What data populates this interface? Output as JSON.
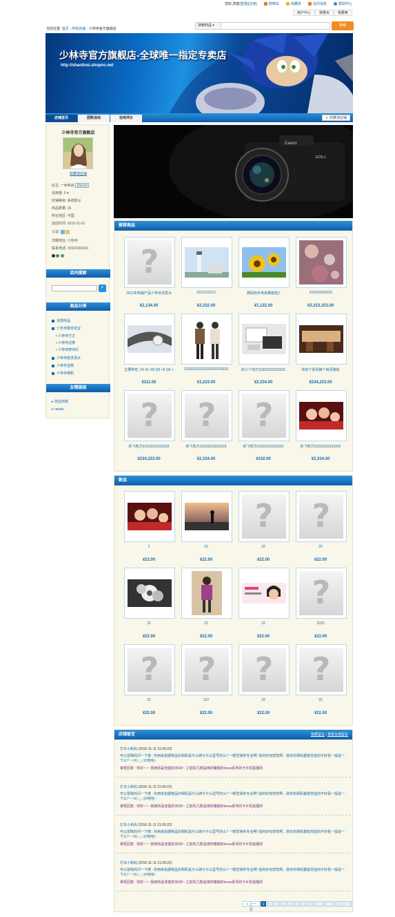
{
  "topbar": {
    "greeting": "您好,游客",
    "login": "[登录]",
    "register": "[注册]",
    "links": [
      {
        "label": "购物车",
        "icon": "cart-icon",
        "color": "#e07c1e"
      },
      {
        "label": "收藏夹",
        "icon": "star-icon",
        "color": "#f2b320"
      },
      {
        "label": "站内消息",
        "icon": "mail-icon",
        "color": "#e07c1e"
      },
      {
        "label": "帮助中心",
        "icon": "help-icon",
        "color": "#2a8fd8"
      }
    ],
    "user_menu": [
      "用户中心",
      "我要买",
      "我要卖"
    ]
  },
  "breadcrumb": {
    "prefix": "当前位置:",
    "items": [
      "首页",
      "所有店铺",
      "少林寺官方旗舰店"
    ]
  },
  "search": {
    "category": "搜索商品",
    "placeholder": "",
    "button": "搜索"
  },
  "banner": {
    "title": "少林寺官方旗舰店-全球唯一指定专卖店",
    "url": "http://shaolinsi.shopnc.net"
  },
  "nav": {
    "tabs": [
      "店铺首页",
      "团购活动",
      "信用评价"
    ],
    "favorite": "收藏该店铺"
  },
  "store": {
    "name": "少林寺官方旗舰店",
    "favorite_link": "收藏该店铺",
    "info": [
      {
        "label": "店主:",
        "value": "一休和尚",
        "tag": "发站内信"
      },
      {
        "label": "信用度:",
        "value": "0"
      },
      {
        "label": "店铺等级:",
        "value": "系统默认"
      },
      {
        "label": "商品数量:",
        "value": "26"
      },
      {
        "label": "所在地区:",
        "value": "中国"
      },
      {
        "label": "创店时间:",
        "value": "2010-11-22"
      },
      {
        "label": "认证:",
        "value": ""
      },
      {
        "label": "详细地址:",
        "value": "少林寺"
      },
      {
        "label": "联系电话:",
        "value": "15922282341"
      }
    ]
  },
  "sidebar": {
    "search_title": "店内搜索",
    "search_placeholder": "",
    "category_title": "商品分类",
    "categories": [
      {
        "label": "全部商品",
        "level": 0
      },
      {
        "label": "少年寺蕾寺龙宝",
        "level": 0
      },
      {
        "label": "少林寺方丈",
        "level": 1
      },
      {
        "label": "少林寺达摩",
        "level": 1
      },
      {
        "label": "少林寺摩诃衍",
        "level": 1
      },
      {
        "label": "少林寺唐洗发水",
        "level": 0
      },
      {
        "label": "少林寺宝典",
        "level": 0
      },
      {
        "label": "少林寺相机",
        "level": 0
      }
    ],
    "links_title": "友情链接",
    "links": [
      "淘宝商城",
      "ramdu"
    ]
  },
  "recommended": {
    "title": "推荐商品",
    "items": [
      {
        "name": "2012年热销产品少林寺洗发水",
        "price": "¥2,134.00",
        "img": "placeholder"
      },
      {
        "name": "2222222222",
        "price": "¥2,332.00",
        "img": "lighthouse"
      },
      {
        "name": "数码的手电系螺旋型2",
        "price": "¥1,122.00",
        "img": "sunflower"
      },
      {
        "name": "333333333333",
        "price": "¥3,333,333.00",
        "img": "bokeh"
      },
      {
        "name": "主要特性: (% W. H8 Q5 >8 Q5 >",
        "price": "¥111.00",
        "img": "watch"
      },
      {
        "name": "23333333333333333333333",
        "price": "¥3,223.00",
        "img": "fashion"
      },
      {
        "name": "的三十地方33333333333333",
        "price": "¥2,334.00",
        "img": "desk"
      },
      {
        "name": "的的个的风格个和风格和",
        "price": "¥234,223.00",
        "img": "room"
      },
      {
        "name": "的飞地方33333333333333",
        "price": "¥234,223.00",
        "img": "placeholder"
      },
      {
        "name": "的飞地方33333333333333",
        "price": "¥2,334.00",
        "img": "placeholder"
      },
      {
        "name": "的飞地方33333333333333",
        "price": "¥332.00",
        "img": "placeholder"
      },
      {
        "name": "的飞地方33333333333333",
        "price": "¥2,334.00",
        "img": "party"
      }
    ]
  },
  "newproducts": {
    "title": "新品",
    "items": [
      {
        "name": "2",
        "price": "¥22.00",
        "img": "party"
      },
      {
        "name": "22",
        "price": "¥22.00",
        "img": "sunset"
      },
      {
        "name": "22",
        "price": "¥22.00",
        "img": "placeholder"
      },
      {
        "name": "22",
        "price": "¥22.00",
        "img": "placeholder"
      },
      {
        "name": "22",
        "price": "¥22.00",
        "img": "flower"
      },
      {
        "name": "22",
        "price": "¥22.00",
        "img": "girl"
      },
      {
        "name": "22",
        "price": "¥22.00",
        "img": "ad"
      },
      {
        "name": "2222",
        "price": "¥22.00",
        "img": "placeholder"
      },
      {
        "name": "22",
        "price": "¥22.00",
        "img": "placeholder"
      },
      {
        "name": "222",
        "price": "¥22.00",
        "img": "placeholder"
      },
      {
        "name": "22",
        "price": "¥22.00",
        "img": "placeholder"
      },
      {
        "name": "22",
        "price": "¥22.00",
        "img": "placeholder"
      }
    ]
  },
  "messages": {
    "title": "店铺留言",
    "links": [
      "我要留言",
      "查看全部留言"
    ],
    "items": [
      {
        "author": "打伞小和尚",
        "time": "(2010-11-11 21:00:22)",
        "text": "可以冒昧的问一下楼 : 你用来拍摄物品的相机是什么牌子什么型号的么? 一眼觉得你专业啊! 拍的好有感觉啊…我买的相机都能觉拍的不好看一般说一下么? ~~0(∩_∩)O哈哈~",
        "reply": "掌柜回复 : 你好~~~ 我用的是佳能的350D~ 之前的几款是用的罐装的lexus系列的卡片机拍摄的"
      },
      {
        "author": "打伞小和尚",
        "time": "(2010-11-11 21:00:22)",
        "text": "可以冒昧的问一下楼 : 你用来拍摄物品的相机是什么牌子什么型号的么? 一眼觉得你专业啊! 拍的好有感觉啊…我买的相机都能觉拍的不好看一般说一下么? ~~0(∩_∩)O哈哈~",
        "reply": "掌柜回复 : 你好~~~ 我用的是佳能的350D~ 之前的几款是用的罐装的lexus系列的卡片机拍摄的"
      },
      {
        "author": "打伞小和尚",
        "time": "(2010-11-11 21:00:22)",
        "text": "可以冒昧的问一下楼 : 你用来拍摄物品的相机是什么牌子什么型号的么? 一眼觉得你专业啊! 拍的好有感觉啊…我买的相机都能觉拍的不好看一般说一下么? ~~0(∩_∩)O哈哈~",
        "reply": "掌柜回复 : 你好~~~ 我用的是佳能的350D~ 之前的几款是用的罐装的lexus系列的卡片机拍摄的"
      },
      {
        "author": "打伞小和尚",
        "time": "(2010-11-11 21:00:22)",
        "text": "可以冒昧的问一下楼 : 你用来拍摄物品的相机是什么牌子什么型号的么? 一眼觉得你专业啊! 拍的好有感觉啊…我买的相机都能觉拍的不好看一般说一下么? ~~0(∩_∩)O哈哈~",
        "reply": "掌柜回复 : 你好~~~ 我用的是佳能的350D~ 之前的几款是用的罐装的lexus系列的卡片机拍摄的"
      }
    ]
  },
  "pager": {
    "prev": "< 上一页",
    "pages": [
      "1",
      "2",
      "3",
      "4",
      "5",
      "6",
      "7",
      "...",
      "199",
      "200"
    ],
    "next": "下一页 >",
    "current": "1"
  },
  "colors": {
    "accent": "#1a6aa8",
    "header_blue": "#0d5eac",
    "sidebar_bg": "#f8f7ea",
    "search_button": "#f28c1e"
  }
}
